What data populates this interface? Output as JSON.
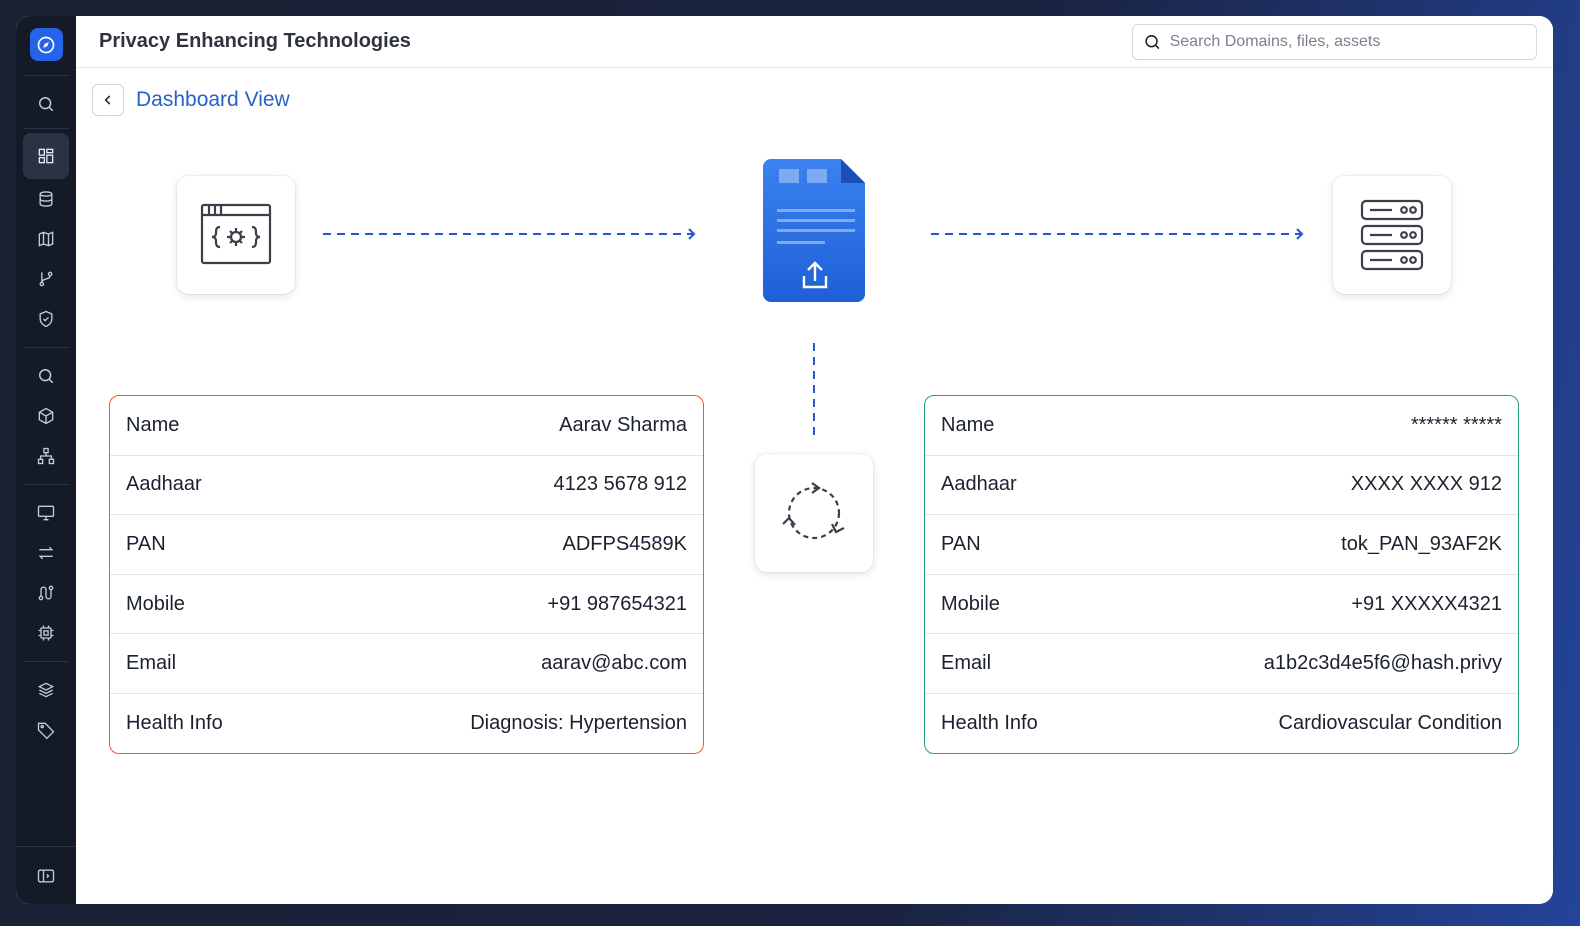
{
  "header": {
    "title": "Privacy Enhancing Technologies",
    "search_placeholder": "Search Domains, files, assets"
  },
  "breadcrumb": {
    "label": "Dashboard View"
  },
  "colors": {
    "accent": "#2563eb",
    "original_border": "#f05a2a",
    "masked_border": "#22a37a",
    "sidebar_bg": "#141a28"
  },
  "sidebar": {
    "logo_icon": "compass-icon",
    "items": [
      {
        "icon": "search-icon"
      },
      {
        "icon": "dashboard-icon",
        "active": true
      },
      {
        "icon": "database-icon"
      },
      {
        "icon": "map-icon"
      },
      {
        "icon": "git-branch-icon"
      },
      {
        "icon": "shield-check-icon"
      },
      {
        "icon": "search-icon"
      },
      {
        "icon": "cube-icon"
      },
      {
        "icon": "hierarchy-icon"
      },
      {
        "icon": "monitor-icon"
      },
      {
        "icon": "transfer-icon"
      },
      {
        "icon": "route-icon"
      },
      {
        "icon": "chip-icon"
      },
      {
        "icon": "layers-icon"
      },
      {
        "icon": "tag-icon"
      }
    ],
    "collapse_icon": "sidebar-expand-icon"
  },
  "diagram": {
    "source_icon": "code-window-icon",
    "document_icon": "document-upload-icon",
    "target_icon": "server-icon",
    "transform_icon": "refresh-icon"
  },
  "original_record": {
    "rows": [
      {
        "label": "Name",
        "value": "Aarav Sharma"
      },
      {
        "label": "Aadhaar",
        "value": "4123 5678 912"
      },
      {
        "label": "PAN",
        "value": "ADFPS4589K"
      },
      {
        "label": "Mobile",
        "value": "+91 987654321"
      },
      {
        "label": "Email",
        "value": "aarav@abc.com"
      },
      {
        "label": "Health Info",
        "value": "Diagnosis: Hypertension"
      }
    ]
  },
  "masked_record": {
    "rows": [
      {
        "label": "Name",
        "value": "****** *****"
      },
      {
        "label": "Aadhaar",
        "value": "XXXX XXXX 912"
      },
      {
        "label": "PAN",
        "value": "tok_PAN_93AF2K"
      },
      {
        "label": "Mobile",
        "value": "+91 XXXXX4321"
      },
      {
        "label": "Email",
        "value": "a1b2c3d4e5f6@hash.privy"
      },
      {
        "label": "Health Info",
        "value": "Cardiovascular Condition"
      }
    ]
  }
}
